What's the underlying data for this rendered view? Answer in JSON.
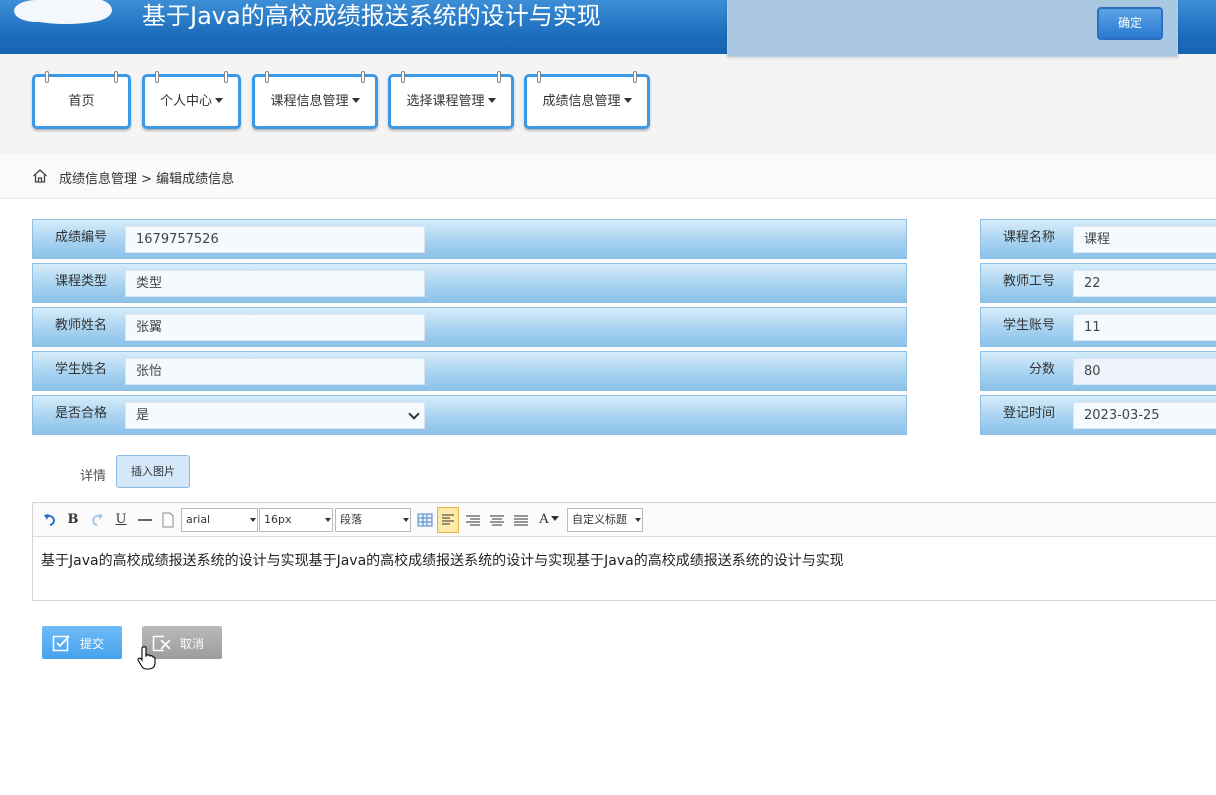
{
  "header": {
    "title": "基于Java的高校成绩报送系统的设计与实现"
  },
  "popup": {
    "ok_label": "确定"
  },
  "nav": {
    "items": [
      {
        "label": "首页",
        "has_dropdown": false
      },
      {
        "label": "个人中心",
        "has_dropdown": true
      },
      {
        "label": "课程信息管理",
        "has_dropdown": true
      },
      {
        "label": "选择课程管理",
        "has_dropdown": true
      },
      {
        "label": "成绩信息管理",
        "has_dropdown": true
      }
    ]
  },
  "breadcrumb": {
    "text": "成绩信息管理 > 编辑成绩信息"
  },
  "form": {
    "left": [
      {
        "label": "成绩编号",
        "value": "1679757526"
      },
      {
        "label": "课程类型",
        "value": "类型"
      },
      {
        "label": "教师姓名",
        "value": "张翼"
      },
      {
        "label": "学生姓名",
        "value": "张怡"
      },
      {
        "label": "是否合格",
        "value": "是",
        "type": "select"
      }
    ],
    "right": [
      {
        "label": "课程名称",
        "value": "课程"
      },
      {
        "label": "教师工号",
        "value": "22"
      },
      {
        "label": "学生账号",
        "value": "11"
      },
      {
        "label": "分数",
        "value": "80"
      },
      {
        "label": "登记时间",
        "value": "2023-03-25"
      }
    ],
    "detail_label": "详情",
    "insert_image_label": "插入图片"
  },
  "editor": {
    "font_family": "arial",
    "font_size": "16px",
    "paragraph": "段落",
    "custom_title": "自定义标题",
    "bold_glyph": "B",
    "underline_glyph": "U",
    "font_color_glyph": "A",
    "content": "基于Java的高校成绩报送系统的设计与实现基于Java的高校成绩报送系统的设计与实现基于Java的高校成绩报送系统的设计与实现"
  },
  "actions": {
    "submit_label": "提交",
    "cancel_label": "取消"
  },
  "colors": {
    "header_blue": "#1e6fbf",
    "nav_border": "#3a9ae8",
    "row_blue": "#a8d3f1",
    "submit_blue": "#47a3ee",
    "cancel_gray": "#9d9d9d"
  }
}
